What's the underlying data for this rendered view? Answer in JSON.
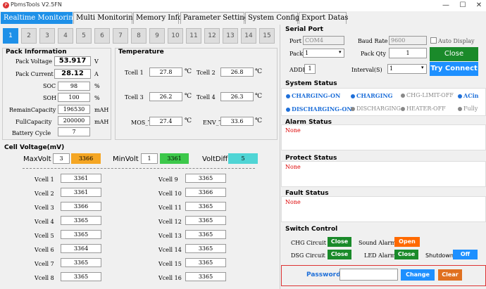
{
  "window": {
    "title": "PbmsTools V2.5FN",
    "minimize_glyph": "—",
    "maximize_glyph": "☐",
    "close_glyph": "✕"
  },
  "tabs": [
    "Realtime Monitoring",
    "Multi Monitoring",
    "Memory Info.",
    "Parameter Setting",
    "System Config.",
    "Export Datas"
  ],
  "packs": [
    "1",
    "2",
    "3",
    "4",
    "5",
    "6",
    "7",
    "8",
    "9",
    "10",
    "11",
    "12",
    "13",
    "14",
    "15"
  ],
  "pack_info": {
    "title": "Pack Information",
    "rows": [
      {
        "label": "Pack Voltage",
        "value": "53.917",
        "unit": "V"
      },
      {
        "label": "Pack Current",
        "value": "28.12",
        "unit": "A"
      },
      {
        "label": "SOC",
        "value": "98",
        "unit": "%"
      },
      {
        "label": "SOH",
        "value": "100",
        "unit": "%"
      },
      {
        "label": "RemainCapacity",
        "value": "196530",
        "unit": "mAH"
      },
      {
        "label": "FullCapacity",
        "value": "200000",
        "unit": "mAH"
      },
      {
        "label": "Battery Cycle",
        "value": "7",
        "unit": ""
      }
    ]
  },
  "temperature": {
    "title": "Temperature",
    "unit": "℃",
    "rows": [
      {
        "label": "Tcell 1",
        "value": "27.8"
      },
      {
        "label": "Tcell 2",
        "value": "26.8"
      },
      {
        "label": "Tcell 3",
        "value": "26.2"
      },
      {
        "label": "Tcell 4",
        "value": "26.3"
      },
      {
        "label": "MOS_T",
        "value": "27.4"
      },
      {
        "label": "ENV_T",
        "value": "33.6"
      }
    ]
  },
  "cell_voltage": {
    "title": "Cell Voltage(mV)",
    "max_label": "MaxVolt",
    "max_idx": "3",
    "max_val": "3366",
    "min_label": "MinVolt",
    "min_idx": "1",
    "min_val": "3361",
    "diff_label": "VoltDiff",
    "diff_val": "5",
    "cells": [
      {
        "label": "Vcell 1",
        "value": "3361"
      },
      {
        "label": "Vcell 2",
        "value": "3361"
      },
      {
        "label": "Vcell 3",
        "value": "3366"
      },
      {
        "label": "Vcell 4",
        "value": "3365"
      },
      {
        "label": "Vcell 5",
        "value": "3365"
      },
      {
        "label": "Vcell 6",
        "value": "3364"
      },
      {
        "label": "Vcell 7",
        "value": "3365"
      },
      {
        "label": "Vcell 8",
        "value": "3365"
      },
      {
        "label": "Vcell 9",
        "value": "3365"
      },
      {
        "label": "Vcell 10",
        "value": "3366"
      },
      {
        "label": "Vcell 11",
        "value": "3365"
      },
      {
        "label": "Vcell 12",
        "value": "3365"
      },
      {
        "label": "Vcell 13",
        "value": "3365"
      },
      {
        "label": "Vcell 14",
        "value": "3365"
      },
      {
        "label": "Vcell 15",
        "value": "3365"
      },
      {
        "label": "Vcell 16",
        "value": "3365"
      }
    ]
  },
  "serial": {
    "title": "Serial Port",
    "port_label": "Port",
    "port_value": "COM4",
    "baud_label": "Baud Rate",
    "baud_value": "9600",
    "auto_label": "Auto Display",
    "pack_label": "Pack",
    "pack_value": "1",
    "packqty_label": "Pack Qty",
    "packqty_value": "1",
    "close_btn": "Close",
    "addr_label": "ADDR",
    "addr_value": "1",
    "interval_label": "Interval(S)",
    "interval_value": "1",
    "try_btn": "Try Connect"
  },
  "system_status": {
    "title": "System Status",
    "items": [
      {
        "text": "CHARGING-ON",
        "color": "#1e6fd9",
        "bold": true
      },
      {
        "text": "CHARGING",
        "color": "#1e6fd9",
        "bold": true
      },
      {
        "text": "CHG-LIMIT-OFF",
        "color": "#888888",
        "bold": false
      },
      {
        "text": "ACin",
        "color": "#1e6fd9",
        "bold": true
      },
      {
        "text": "DISCHARGING-ON",
        "color": "#1e6fd9",
        "bold": true
      },
      {
        "text": "DISCHARGING",
        "color": "#888888",
        "bold": false
      },
      {
        "text": "HEATER-OFF",
        "color": "#888888",
        "bold": false
      },
      {
        "text": "Fully",
        "color": "#888888",
        "bold": false
      }
    ]
  },
  "alarm": {
    "title": "Alarm Status",
    "value": "None"
  },
  "protect": {
    "title": "Protect Status",
    "value": "None"
  },
  "fault": {
    "title": "Fault Status",
    "value": "None"
  },
  "switch": {
    "title": "Switch Control",
    "chg_label": "CHG Circuit",
    "chg_btn": "Close",
    "sound_label": "Sound Alarm",
    "sound_btn": "Open",
    "dsg_label": "DSG Circuit",
    "dsg_btn": "Close",
    "led_label": "LED Alarm",
    "led_btn": "Close",
    "shutdown_label": "Shutdown",
    "shutdown_btn": "Off"
  },
  "password": {
    "label": "Password",
    "value": "",
    "change_btn": "Change",
    "clear_btn": "Clear"
  }
}
